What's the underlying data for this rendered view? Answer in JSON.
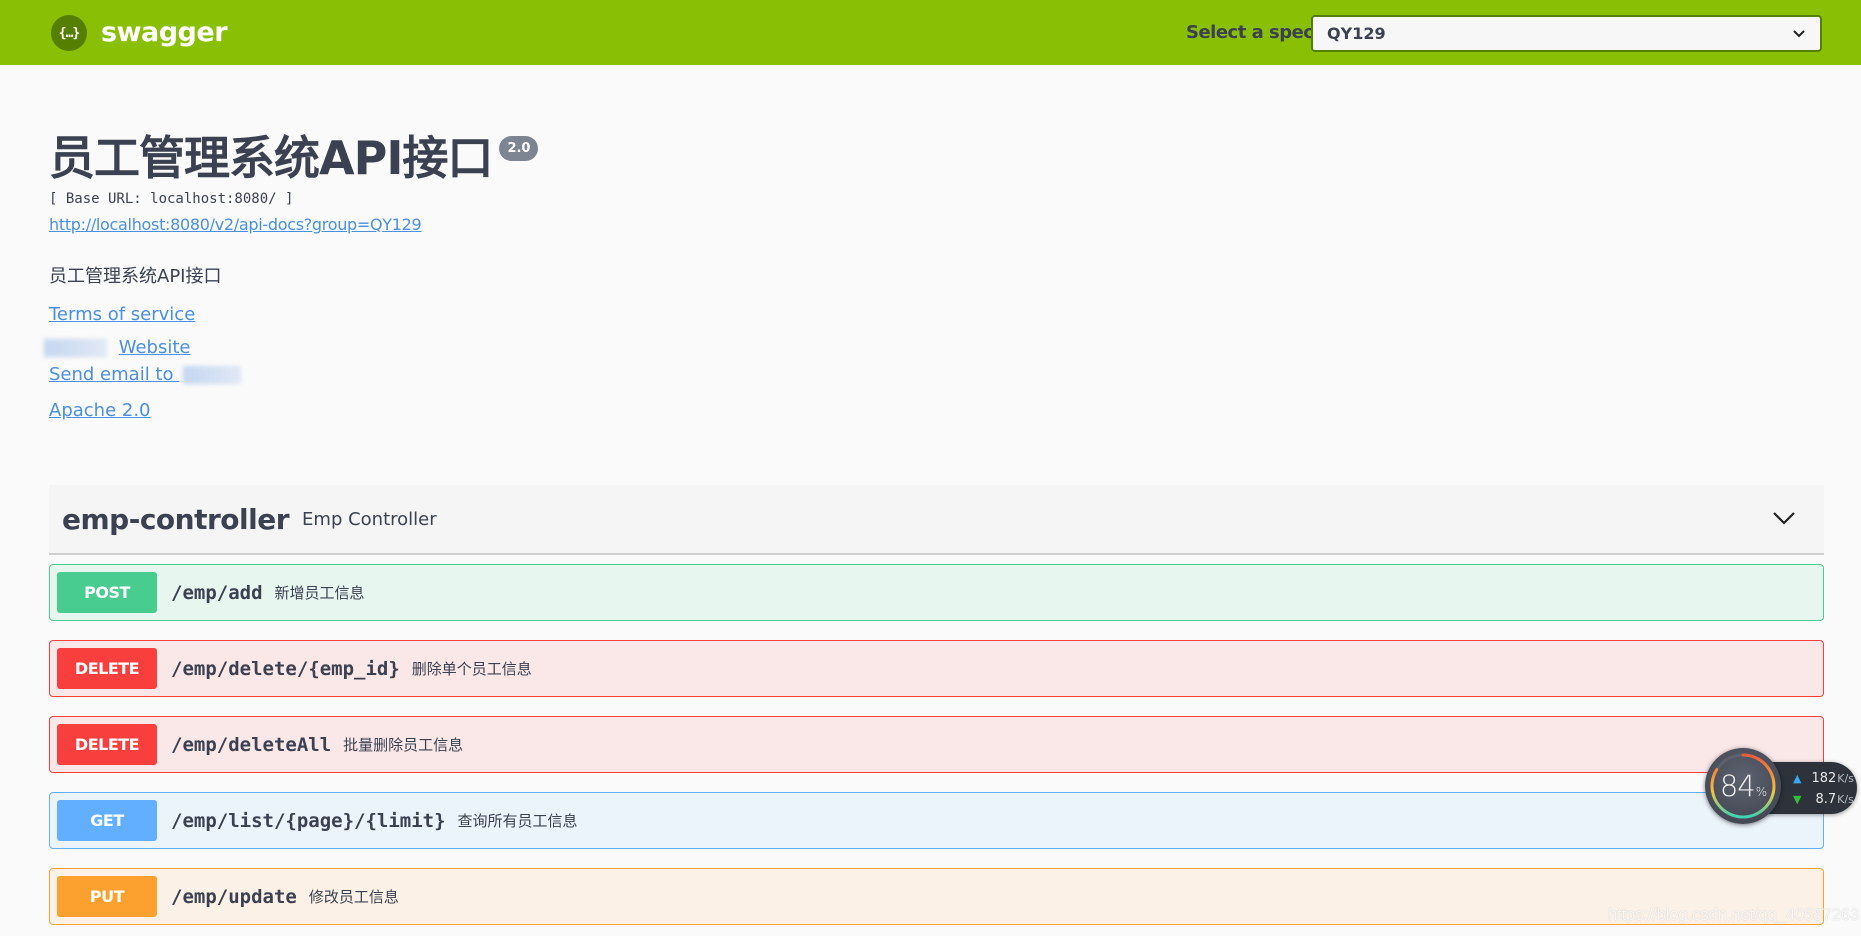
{
  "topbar": {
    "logo_glyph": "{…}",
    "brand": "swagger",
    "spec_label": "Select a spec",
    "spec_selected": "QY129",
    "logo_icon": "swagger-logo-icon",
    "chevron_icon": "chevron-down-icon"
  },
  "info": {
    "title": "员工管理系统API接口",
    "version": "2.0",
    "base_url": "[ Base URL: localhost:8080/ ]",
    "spec_url": "http://localhost:8080/v2/api-docs?group=QY129",
    "description": "员工管理系统API接口",
    "terms_of_service": "Terms of service",
    "website": "Website",
    "send_email": "Send email to",
    "license": "Apache 2.0"
  },
  "controller": {
    "name": "emp-controller",
    "description": "Emp Controller",
    "expanded": true
  },
  "operations": [
    {
      "method": "POST",
      "path": "/emp/add",
      "summary": "新增员工信息",
      "color": "#49cc90"
    },
    {
      "method": "DELETE",
      "path": "/emp/delete/{emp_id}",
      "summary": "删除单个员工信息",
      "color": "#f93e3e"
    },
    {
      "method": "DELETE",
      "path": "/emp/deleteAll",
      "summary": "批量删除员工信息",
      "color": "#f93e3e"
    },
    {
      "method": "GET",
      "path": "/emp/list/{page}/{limit}",
      "summary": "查询所有员工信息",
      "color": "#61affe"
    },
    {
      "method": "PUT",
      "path": "/emp/update",
      "summary": "修改员工信息",
      "color": "#fca130"
    }
  ],
  "network_widget": {
    "usage_percent": 84,
    "usage_value": "84",
    "usage_unit": "%",
    "upload_value": "182",
    "upload_unit": "K/s",
    "download_value": "8.7",
    "download_unit": "K/s"
  },
  "watermark": "https://blog.csdn.net/qq_40587263",
  "colors": {
    "topbar": "#89bf04",
    "topbar_dark": "#547f00",
    "link": "#4990e2",
    "text": "#3b4151"
  }
}
